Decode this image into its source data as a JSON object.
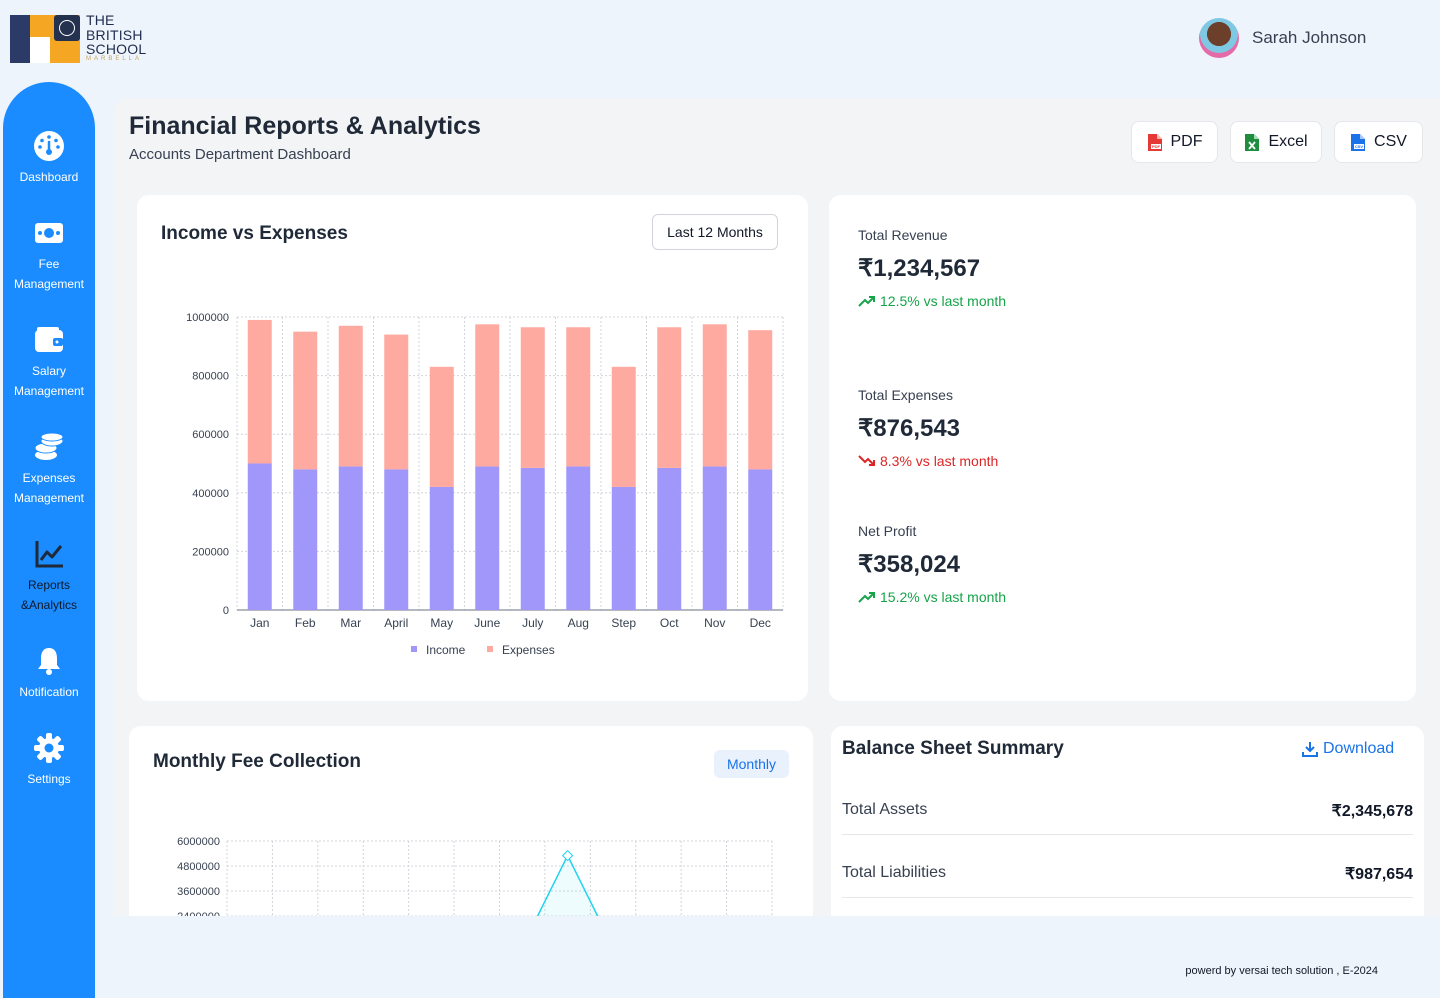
{
  "brand": {
    "line1": "THE",
    "line2": "BRITISH",
    "line3": "SCHOOL",
    "sub": "MARBELLA"
  },
  "user": {
    "name": "Sarah Johnson"
  },
  "sidebar": {
    "items": [
      {
        "label": "Dashboard",
        "icon": "dashboard-gauge-icon"
      },
      {
        "label": "Fee\nManagement",
        "icon": "money-bill-icon"
      },
      {
        "label": "Salary\nManagement",
        "icon": "wallet-icon"
      },
      {
        "label": "Expenses\nManagement",
        "icon": "coins-stack-icon"
      },
      {
        "label": "Reports\n&Analytics",
        "icon": "line-chart-icon"
      },
      {
        "label": "Notification",
        "icon": "bell-icon"
      },
      {
        "label": "Settings",
        "icon": "gear-icon"
      }
    ]
  },
  "page": {
    "title": "Financial Reports & Analytics",
    "subtitle": "Accounts Department Dashboard"
  },
  "exports": {
    "pdf": "PDF",
    "excel": "Excel",
    "csv": "CSV"
  },
  "income_expenses": {
    "title": "Income vs Expenses",
    "range": "Last 12 Months"
  },
  "stats": {
    "revenue": {
      "label": "Total Revenue",
      "value": "₹1,234,567",
      "trend": "12.5% vs last month",
      "direction": "up"
    },
    "expenses": {
      "label": "Total Expenses",
      "value": "₹876,543",
      "trend": "8.3% vs last month",
      "direction": "down"
    },
    "profit": {
      "label": "Net Profit",
      "value": "₹358,024",
      "trend": "15.2% vs last month",
      "direction": "up"
    }
  },
  "fee_collection": {
    "title": "Monthly Fee Collection",
    "period": "Monthly"
  },
  "balance_sheet": {
    "title": "Balance Sheet Summary",
    "download": "Download",
    "rows": [
      {
        "label": "Total Assets",
        "value": "₹2,345,678"
      },
      {
        "label": "Total Liabilities",
        "value": "₹987,654"
      }
    ]
  },
  "footer": {
    "text": "powerd by versai tech solution , E-2024"
  },
  "colors": {
    "sidebar": "#1a8cff",
    "income": "#a197fb",
    "expenses": "#ffaaa0",
    "up": "#16a34a",
    "down": "#dc2626",
    "line": "#22d3ee"
  },
  "chart_data": [
    {
      "type": "bar",
      "stacked": true,
      "categories": [
        "Jan",
        "Feb",
        "Mar",
        "April",
        "May",
        "June",
        "July",
        "Aug",
        "Step",
        "Oct",
        "Nov",
        "Dec"
      ],
      "series": [
        {
          "name": "Income",
          "values": [
            500000,
            480000,
            490000,
            480000,
            420000,
            490000,
            485000,
            490000,
            420000,
            485000,
            490000,
            480000
          ]
        },
        {
          "name": "Expenses",
          "values": [
            490000,
            470000,
            480000,
            460000,
            410000,
            485000,
            480000,
            475000,
            410000,
            480000,
            485000,
            475000
          ]
        }
      ],
      "yticks": [
        0,
        200000,
        400000,
        600000,
        800000,
        1000000
      ],
      "ylim": [
        0,
        1000000
      ],
      "legend": "bottom",
      "grid": true
    },
    {
      "type": "line",
      "yticks": [
        2400000,
        3600000,
        4800000,
        6000000
      ],
      "visible_points": [
        {
          "index": 7,
          "value": 5300000
        }
      ],
      "grid": true
    }
  ]
}
